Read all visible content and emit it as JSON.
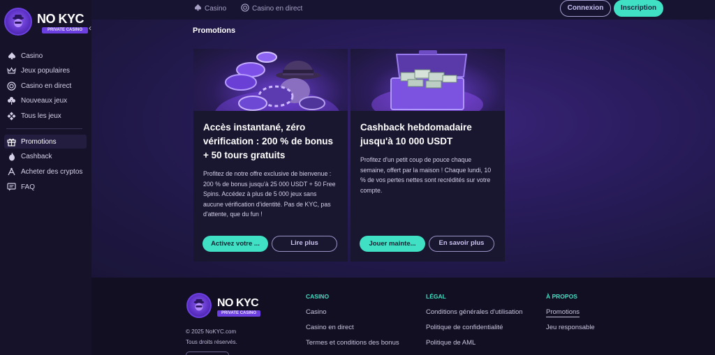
{
  "brand": {
    "name": "NO KYC",
    "tagline": "PRIVATE CASINO"
  },
  "colors": {
    "accent": "#3fe0c3",
    "primary_purple": "#6b3fe0",
    "background": "#1a1630"
  },
  "topbar": {
    "links": [
      {
        "label": "Casino",
        "icon": "spade-icon"
      },
      {
        "label": "Casino en direct",
        "icon": "live-chip-icon"
      }
    ],
    "login_label": "Connexion",
    "signup_label": "Inscription"
  },
  "sidebar": {
    "items": [
      {
        "label": "Casino",
        "icon": "spade-icon"
      },
      {
        "label": "Jeux populaires",
        "icon": "crown-icon"
      },
      {
        "label": "Casino en direct",
        "icon": "live-chip-icon"
      },
      {
        "label": "Nouveaux jeux",
        "icon": "clover-icon"
      },
      {
        "label": "Tous les jeux",
        "icon": "grid-icon"
      }
    ],
    "items2": [
      {
        "label": "Promotions",
        "icon": "gift-icon",
        "active": true
      },
      {
        "label": "Cashback",
        "icon": "flame-icon"
      },
      {
        "label": "Acheter des cryptos",
        "icon": "crypto-icon"
      },
      {
        "label": "FAQ",
        "icon": "faq-icon"
      }
    ]
  },
  "page": {
    "title": "Promotions"
  },
  "promotions": [
    {
      "title": "Accès instantané, zéro vérification : 200 % de bonus + 50 tours gratuits",
      "description": "Profitez de notre offre exclusive de bienvenue : 200 % de bonus jusqu'à 25 000 USDT + 50 Free Spins. Accédez à plus de 5 000 jeux sans aucune vérification d'identité. Pas de KYC, pas d'attente, que du fun !",
      "primary_label": "Activez votre ...",
      "secondary_label": "Lire plus",
      "image": "casino-chips-mascot"
    },
    {
      "title": "Cashback hebdomadaire jusqu'à 10 000 USDT",
      "description": "Profitez d'un petit coup de pouce chaque semaine, offert par la maison ! Chaque lundi, 10 % de vos pertes nettes sont recrédités sur votre compte.",
      "primary_label": "Jouer mainte...",
      "secondary_label": "En savoir plus",
      "image": "money-suitcase"
    }
  ],
  "footer": {
    "copyright": "© 2025 NoKYC.com",
    "rights": "Tous droits réservés.",
    "columns": [
      {
        "heading": "CASINO",
        "links": [
          "Casino",
          "Casino en direct",
          "Termes et conditions des bonus"
        ]
      },
      {
        "heading": "LÉGAL",
        "links": [
          "Conditions générales d'utilisation",
          "Politique de confidentialité",
          "Politique de AML"
        ]
      },
      {
        "heading": "À PROPOS",
        "links": [
          "Promotions",
          "Jeu responsable"
        ]
      }
    ]
  }
}
